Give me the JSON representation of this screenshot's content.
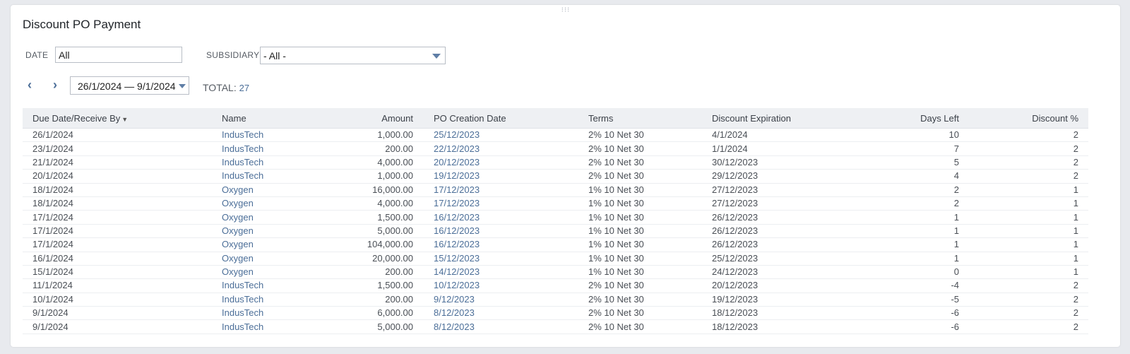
{
  "portlet": {
    "title": "Discount PO Payment",
    "drag_glyph": "⁝⁝⁝"
  },
  "filters": {
    "date_label": "DATE",
    "date_value": "All",
    "subsidiary_label": "SUBSIDIARY",
    "subsidiary_value": "- All -"
  },
  "pager": {
    "prev_icon": "‹",
    "next_icon": "›",
    "range": "26/1/2024 — 9/1/2024",
    "total_label": "TOTAL:",
    "total_value": "27"
  },
  "colors": {
    "link": "#4b6e98",
    "header_bg": "#eef0f3"
  },
  "table": {
    "columns": [
      "Due Date/Receive By",
      "Name",
      "Amount",
      "PO Creation Date",
      "Terms",
      "Discount Expiration",
      "Days Left",
      "Discount %"
    ],
    "sort_icon": "▼",
    "rows": [
      [
        "26/1/2024",
        "IndusTech",
        "1,000.00",
        "25/12/2023",
        "2% 10 Net 30",
        "4/1/2024",
        "10",
        "2"
      ],
      [
        "23/1/2024",
        "IndusTech",
        "200.00",
        "22/12/2023",
        "2% 10 Net 30",
        "1/1/2024",
        "7",
        "2"
      ],
      [
        "21/1/2024",
        "IndusTech",
        "4,000.00",
        "20/12/2023",
        "2% 10 Net 30",
        "30/12/2023",
        "5",
        "2"
      ],
      [
        "20/1/2024",
        "IndusTech",
        "1,000.00",
        "19/12/2023",
        "2% 10 Net 30",
        "29/12/2023",
        "4",
        "2"
      ],
      [
        "18/1/2024",
        "Oxygen",
        "16,000.00",
        "17/12/2023",
        "1% 10 Net 30",
        "27/12/2023",
        "2",
        "1"
      ],
      [
        "18/1/2024",
        "Oxygen",
        "4,000.00",
        "17/12/2023",
        "1% 10 Net 30",
        "27/12/2023",
        "2",
        "1"
      ],
      [
        "17/1/2024",
        "Oxygen",
        "1,500.00",
        "16/12/2023",
        "1% 10 Net 30",
        "26/12/2023",
        "1",
        "1"
      ],
      [
        "17/1/2024",
        "Oxygen",
        "5,000.00",
        "16/12/2023",
        "1% 10 Net 30",
        "26/12/2023",
        "1",
        "1"
      ],
      [
        "17/1/2024",
        "Oxygen",
        "104,000.00",
        "16/12/2023",
        "1% 10 Net 30",
        "26/12/2023",
        "1",
        "1"
      ],
      [
        "16/1/2024",
        "Oxygen",
        "20,000.00",
        "15/12/2023",
        "1% 10 Net 30",
        "25/12/2023",
        "1",
        "1"
      ],
      [
        "15/1/2024",
        "Oxygen",
        "200.00",
        "14/12/2023",
        "1% 10 Net 30",
        "24/12/2023",
        "0",
        "1"
      ],
      [
        "11/1/2024",
        "IndusTech",
        "1,500.00",
        "10/12/2023",
        "2% 10 Net 30",
        "20/12/2023",
        "-4",
        "2"
      ],
      [
        "10/1/2024",
        "IndusTech",
        "200.00",
        "9/12/2023",
        "2% 10 Net 30",
        "19/12/2023",
        "-5",
        "2"
      ],
      [
        "9/1/2024",
        "IndusTech",
        "6,000.00",
        "8/12/2023",
        "2% 10 Net 30",
        "18/12/2023",
        "-6",
        "2"
      ],
      [
        "9/1/2024",
        "IndusTech",
        "5,000.00",
        "8/12/2023",
        "2% 10 Net 30",
        "18/12/2023",
        "-6",
        "2"
      ]
    ]
  }
}
